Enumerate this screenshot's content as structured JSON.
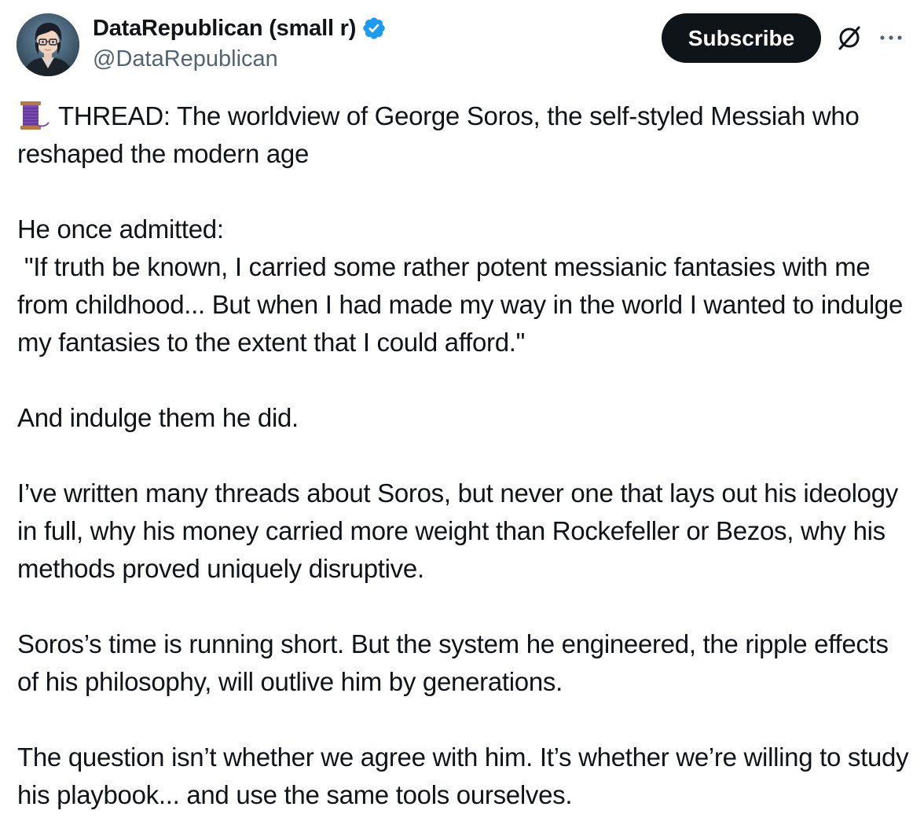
{
  "author": {
    "display_name": "DataRepublican (small r)",
    "handle": "@DataRepublican",
    "verified": true,
    "avatar_icon": "avatar-anime-portrait",
    "verified_color": "#1d9bf0"
  },
  "actions": {
    "subscribe_label": "Subscribe",
    "grok_icon": "grok-icon",
    "more_icon": "more-icon"
  },
  "tweet": {
    "lead_icon": "thread-spool-icon",
    "paragraphs": [
      "THREAD: The worldview of George Soros, the self-styled Messiah who reshaped the modern age",
      "He once admitted:\n \"If truth be known, I carried some rather potent messianic fantasies with me from childhood... But when I had made my way in the world I wanted to indulge my fantasies to the extent that I could afford.\"",
      "And indulge them he did.",
      "I’ve written many threads about Soros, but never one that lays out his ideology in full, why his money carried more weight than Rockefeller or Bezos, why his methods proved uniquely disruptive.",
      "Soros’s time is running short. But the system he engineered, the ripple effects of his philosophy, will outlive him by generations.",
      "The question isn’t whether we agree with him. It’s whether we’re willing to study his playbook... and use the same tools ourselves."
    ]
  },
  "colors": {
    "text": "#0f1419",
    "secondary": "#536471",
    "button_bg": "#0f1419",
    "button_text": "#ffffff"
  }
}
